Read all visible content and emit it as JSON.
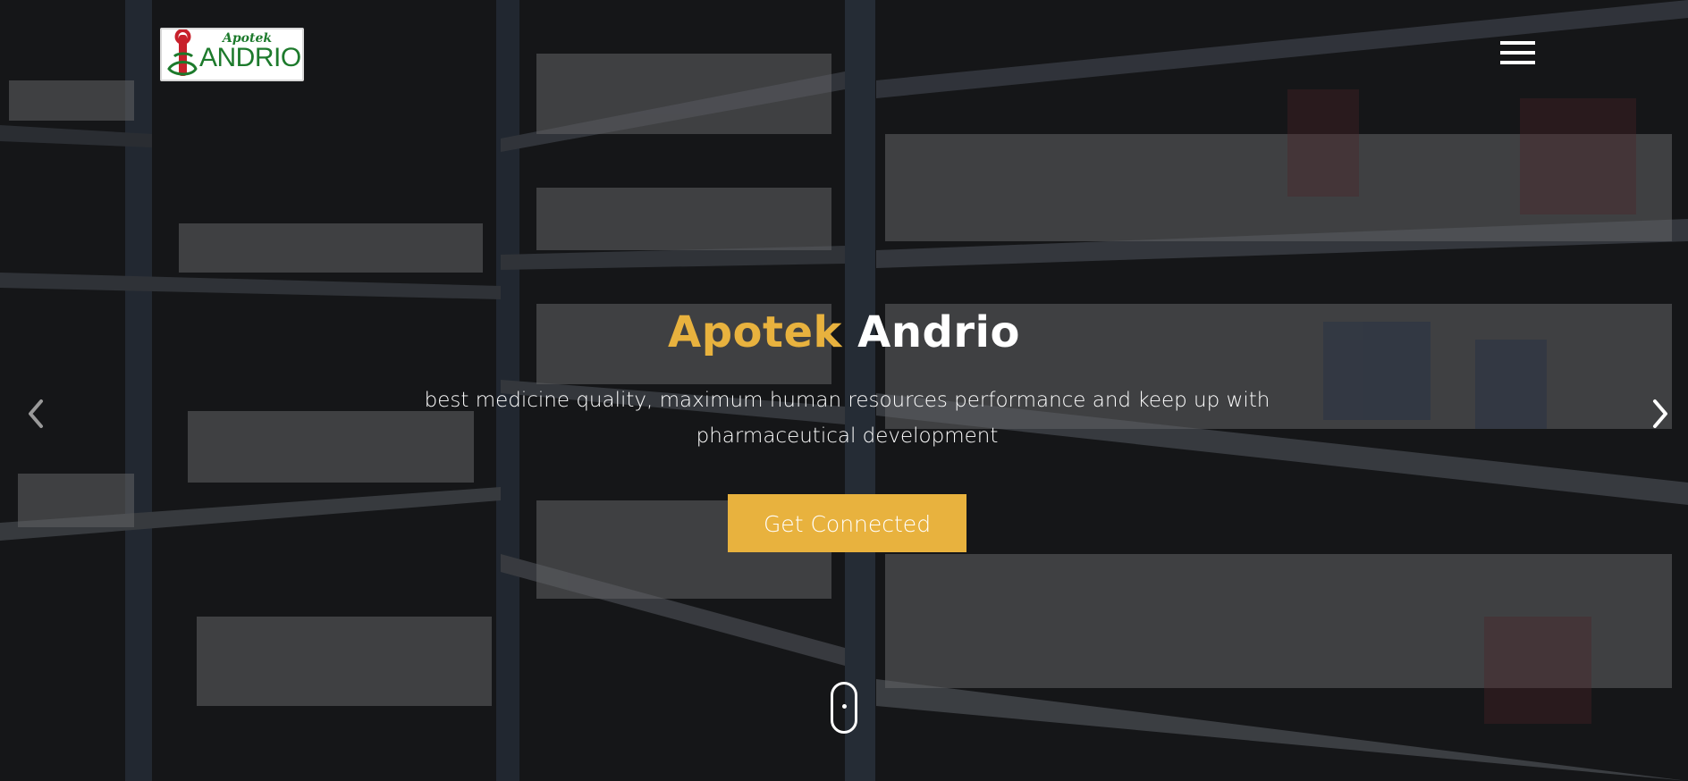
{
  "brand": {
    "logo_small": "Apotek",
    "logo_big": "ANDRIO"
  },
  "hero": {
    "title_accent": "Apotek",
    "title_rest": "Andrio",
    "subtitle": "best medicine quality, maximum human resources performance and keep up with pharmaceutical development",
    "cta_label": "Get Connected"
  },
  "nav": {
    "menu_icon": "hamburger-icon",
    "prev_icon": "chevron-left-icon",
    "next_icon": "chevron-right-icon",
    "scroll_icon": "mouse-scroll-icon"
  },
  "colors": {
    "accent": "#e8b23e",
    "logo_green": "#1d7a2c",
    "logo_red": "#c8202b",
    "text": "#ffffff"
  }
}
